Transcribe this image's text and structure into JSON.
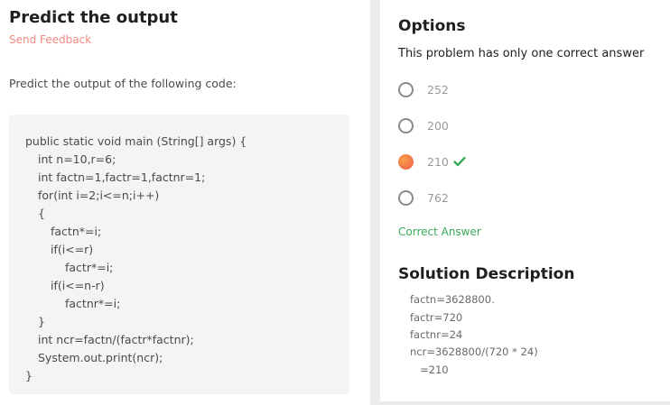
{
  "problem": {
    "title": "Predict the output",
    "feedback_label": "Send Feedback",
    "question": "Predict the output of the following code:",
    "code_lines": [
      "public static void main (String[] args) {",
      "int n=10,r=6;",
      "int factn=1,factr=1,factnr=1;",
      "for(int i=2;i<=n;i++)",
      "{",
      "factn*=i;",
      "if(i<=r)",
      "factr*=i;",
      "if(i<=n-r)",
      "factnr*=i;",
      "}",
      "int ncr=factn/(factr*factnr);",
      "System.out.print(ncr);",
      "}"
    ]
  },
  "options": {
    "title": "Options",
    "subtitle": "This problem has only one correct answer",
    "items": [
      {
        "label": "252",
        "selected": false
      },
      {
        "label": "200",
        "selected": false
      },
      {
        "label": "210",
        "selected": true,
        "correct": true
      },
      {
        "label": "762",
        "selected": false
      }
    ],
    "result_label": "Correct Answer"
  },
  "solution": {
    "title": "Solution Description",
    "lines": [
      "factn=3628800.",
      "factr=720",
      "factnr=24",
      "ncr=3628800/(720 * 24)",
      "=210"
    ]
  },
  "colors": {
    "feedback": "#f08a7e",
    "correct": "#3aab5b",
    "radio_selected_start": "#f7a04a",
    "radio_selected_end": "#ef5a4a"
  }
}
